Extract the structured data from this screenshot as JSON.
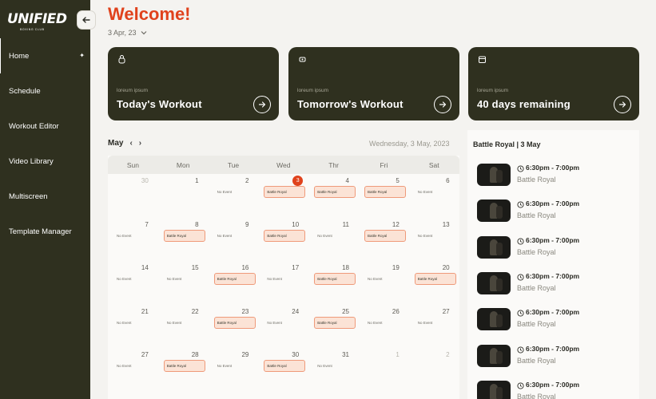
{
  "brand": {
    "name": "UNIFIED",
    "sub": "BOXING CLUB"
  },
  "sidebar": {
    "items": [
      {
        "label": "Home",
        "active": true
      },
      {
        "label": "Schedule"
      },
      {
        "label": "Workout Editor"
      },
      {
        "label": "Video Library"
      },
      {
        "label": "Multiscreen"
      },
      {
        "label": "Template Manager"
      }
    ]
  },
  "header": {
    "title": "Welcome!",
    "date": "3 Apr, 23"
  },
  "cards": [
    {
      "sub": "loreum ipsum",
      "title": "Today's Workout",
      "icon": "kettlebell-icon"
    },
    {
      "sub": "loreum ipsum",
      "title": "Tomorrow's Workout",
      "icon": "dumbbell-icon"
    },
    {
      "sub": "loreum ipsum",
      "title": "40 days remaining",
      "icon": "calendar-icon"
    }
  ],
  "calendar": {
    "month": "May",
    "selected_date": "Wednesday, 3 May, 2023",
    "weekdays": [
      "Sun",
      "Mon",
      "Tue",
      "Wed",
      "Thr",
      "Fri",
      "Sat"
    ],
    "today": "3",
    "weeks": [
      [
        {
          "d": "30",
          "muted": true
        },
        {
          "d": "1"
        },
        {
          "d": "2",
          "e": "No Event"
        },
        {
          "d": "3",
          "e": "Battle Royal",
          "today": true
        },
        {
          "d": "4",
          "e": "Battle Royal"
        },
        {
          "d": "5",
          "e": "Battle Royal"
        },
        {
          "d": "6",
          "e": "No Event"
        }
      ],
      [
        {
          "d": "7",
          "e": "No Event"
        },
        {
          "d": "8",
          "e": "Battle Royal"
        },
        {
          "d": "9",
          "e": "No Event"
        },
        {
          "d": "10",
          "e": "Battle Royal"
        },
        {
          "d": "11",
          "e": "No Event"
        },
        {
          "d": "12",
          "e": "Battle Royal"
        },
        {
          "d": "13",
          "e": "No Event"
        }
      ],
      [
        {
          "d": "14",
          "e": "No Event"
        },
        {
          "d": "15",
          "e": "No Event"
        },
        {
          "d": "16",
          "e": "Battle Royal"
        },
        {
          "d": "17",
          "e": "No Event"
        },
        {
          "d": "18",
          "e": "Battle Royal"
        },
        {
          "d": "19",
          "e": "No Event"
        },
        {
          "d": "20",
          "e": "Battle Royal"
        }
      ],
      [
        {
          "d": "21",
          "e": "No Event"
        },
        {
          "d": "22",
          "e": "No Event"
        },
        {
          "d": "23",
          "e": "Battle Royal"
        },
        {
          "d": "24",
          "e": "No Event"
        },
        {
          "d": "25",
          "e": "Battle Royal"
        },
        {
          "d": "26",
          "e": "No Event"
        },
        {
          "d": "27",
          "e": "No Event"
        }
      ],
      [
        {
          "d": "27",
          "e": "No Event"
        },
        {
          "d": "28",
          "e": "Battle Royal"
        },
        {
          "d": "29",
          "e": "No Event"
        },
        {
          "d": "30",
          "e": "Battle Royal"
        },
        {
          "d": "31",
          "e": "No Event"
        },
        {
          "d": "1",
          "muted": true
        },
        {
          "d": "2",
          "muted": true
        }
      ]
    ]
  },
  "panel": {
    "title": "Battle Royal  |  3 May",
    "sessions": [
      {
        "time": "6:30pm - 7:00pm",
        "name": "Battle Royal"
      },
      {
        "time": "6:30pm - 7:00pm",
        "name": "Battle Royal"
      },
      {
        "time": "6:30pm - 7:00pm",
        "name": "Battle Royal"
      },
      {
        "time": "6:30pm - 7:00pm",
        "name": "Battle Royal"
      },
      {
        "time": "6:30pm - 7:00pm",
        "name": "Battle Royal"
      },
      {
        "time": "6:30pm - 7:00pm",
        "name": "Battle Royal"
      },
      {
        "time": "6:30pm - 7:00pm",
        "name": "Battle Royal"
      }
    ]
  },
  "colors": {
    "accent": "#e0421c",
    "sidebar": "#2f301f",
    "event_fill": "#fbe3d6",
    "event_border": "#ef9a7a"
  }
}
